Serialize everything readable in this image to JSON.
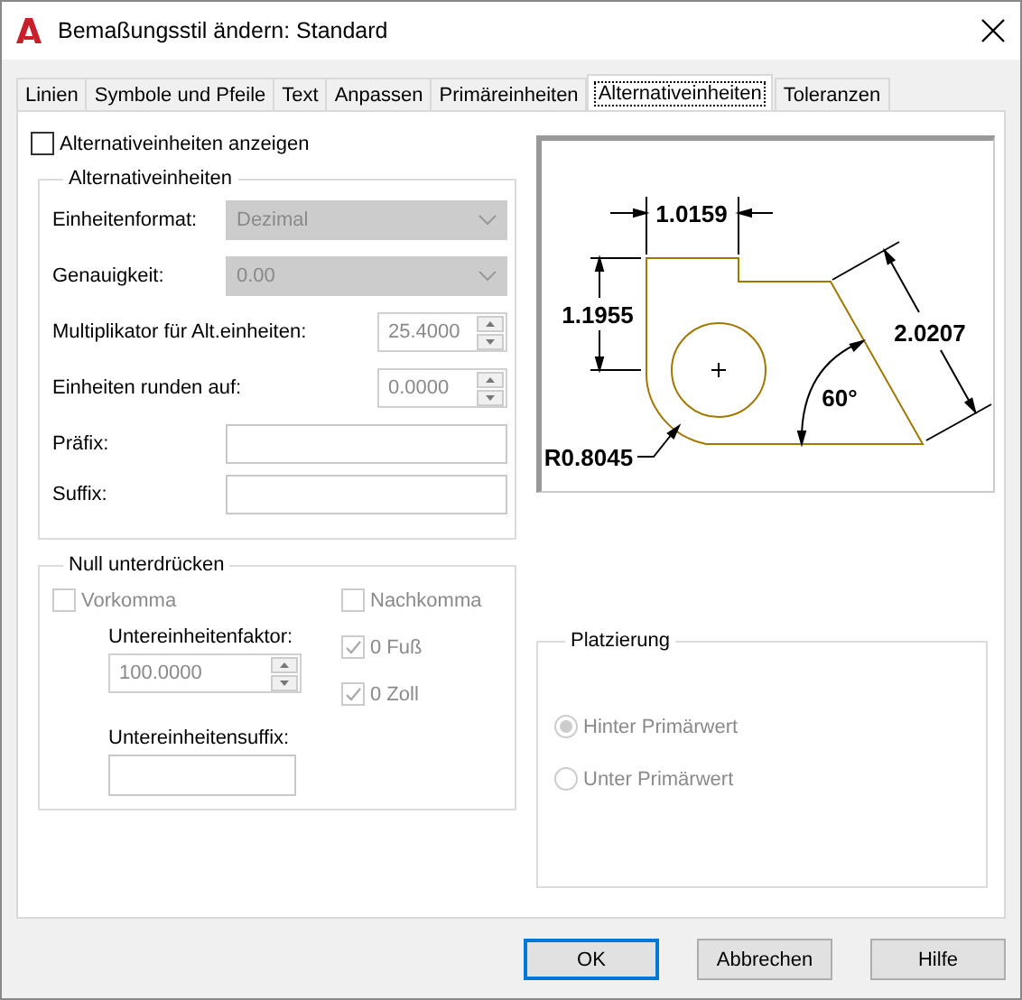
{
  "window": {
    "title": "Bemaßungsstil ändern: Standard"
  },
  "tabs": [
    {
      "label": "Linien",
      "selected": false
    },
    {
      "label": "Symbole und Pfeile",
      "selected": false
    },
    {
      "label": "Text",
      "selected": false
    },
    {
      "label": "Anpassen",
      "selected": false
    },
    {
      "label": "Primäreinheiten",
      "selected": false
    },
    {
      "label": "Alternativeinheiten",
      "selected": true
    },
    {
      "label": "Toleranzen",
      "selected": false
    }
  ],
  "show_alt_units": {
    "label": "Alternativeinheiten anzeigen",
    "checked": false
  },
  "alt_units": {
    "title": "Alternativeinheiten",
    "fields": [
      {
        "kind": "dropdown",
        "label": "Einheitenformat:",
        "value": "Dezimal",
        "disabled": true
      },
      {
        "kind": "dropdown",
        "label": "Genauigkeit:",
        "value": "0.00",
        "disabled": true
      },
      {
        "kind": "spinner",
        "label": "Multiplikator für Alt.einheiten:",
        "value": "25.4000",
        "disabled": true
      },
      {
        "kind": "spinner",
        "label": "Einheiten runden auf:",
        "value": "0.0000",
        "disabled": true
      },
      {
        "kind": "text",
        "label": "Präfix:"
      },
      {
        "kind": "text",
        "label": "Suffix:"
      }
    ]
  },
  "zero_suppression": {
    "title": "Null unterdrücken",
    "leading": {
      "label": "Vorkomma",
      "checked": false,
      "disabled": true
    },
    "subunit_factor": {
      "label": "Untereinheitenfaktor:",
      "value": "100.0000"
    },
    "subunit_suffix": {
      "label": "Untereinheitensuffix:"
    },
    "checkboxes": [
      {
        "label": "Nachkomma",
        "checked": false,
        "disabled": true
      },
      {
        "label": "0 Fuß",
        "checked": true,
        "disabled": true
      },
      {
        "label": "0 Zoll",
        "checked": true,
        "disabled": true
      }
    ]
  },
  "preview": {
    "labels": [
      "1.0159",
      "1.1955",
      "2.0207",
      "60°",
      "R0.8045"
    ]
  },
  "placement": {
    "title": "Platzierung",
    "options": [
      {
        "label": "Hinter Primärwert",
        "selected": true,
        "disabled": true
      },
      {
        "label": "Unter Primärwert",
        "selected": false,
        "disabled": true
      }
    ]
  },
  "buttons": [
    {
      "label": "OK",
      "default": true
    },
    {
      "label": "Abbrechen",
      "default": false
    },
    {
      "label": "Hilfe",
      "default": false
    }
  ]
}
